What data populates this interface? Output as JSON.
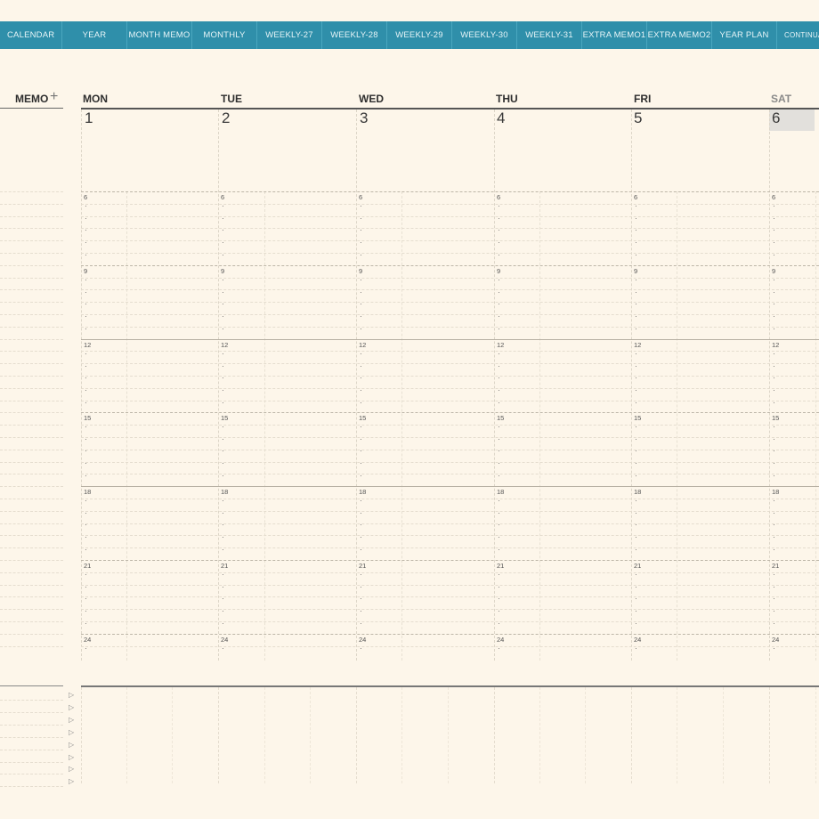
{
  "tabs": [
    "CALENDAR",
    "YEAR",
    "MONTH MEMO",
    "MONTHLY",
    "WEEKLY-27",
    "WEEKLY-28",
    "WEEKLY-29",
    "WEEKLY-30",
    "WEEKLY-31",
    "EXTRA MEMO1",
    "EXTRA MEMO2",
    "YEAR PLAN",
    "CONTINUA"
  ],
  "memo": {
    "label": "MEMO",
    "plus": "+"
  },
  "days": [
    {
      "name": "MON",
      "date": "1"
    },
    {
      "name": "TUE",
      "date": "2"
    },
    {
      "name": "WED",
      "date": "3"
    },
    {
      "name": "THU",
      "date": "4"
    },
    {
      "name": "FRI",
      "date": "5"
    },
    {
      "name": "SAT",
      "date": "6"
    }
  ],
  "hours": [
    "6",
    "9",
    "12",
    "15",
    "18",
    "21",
    "24"
  ],
  "colors": {
    "tab_bg": "#2f8faa",
    "paper": "#fdf6ea",
    "today_highlight": "#e2e0dc"
  },
  "icons": {
    "memo_bullet": "triangle-right-icon"
  }
}
